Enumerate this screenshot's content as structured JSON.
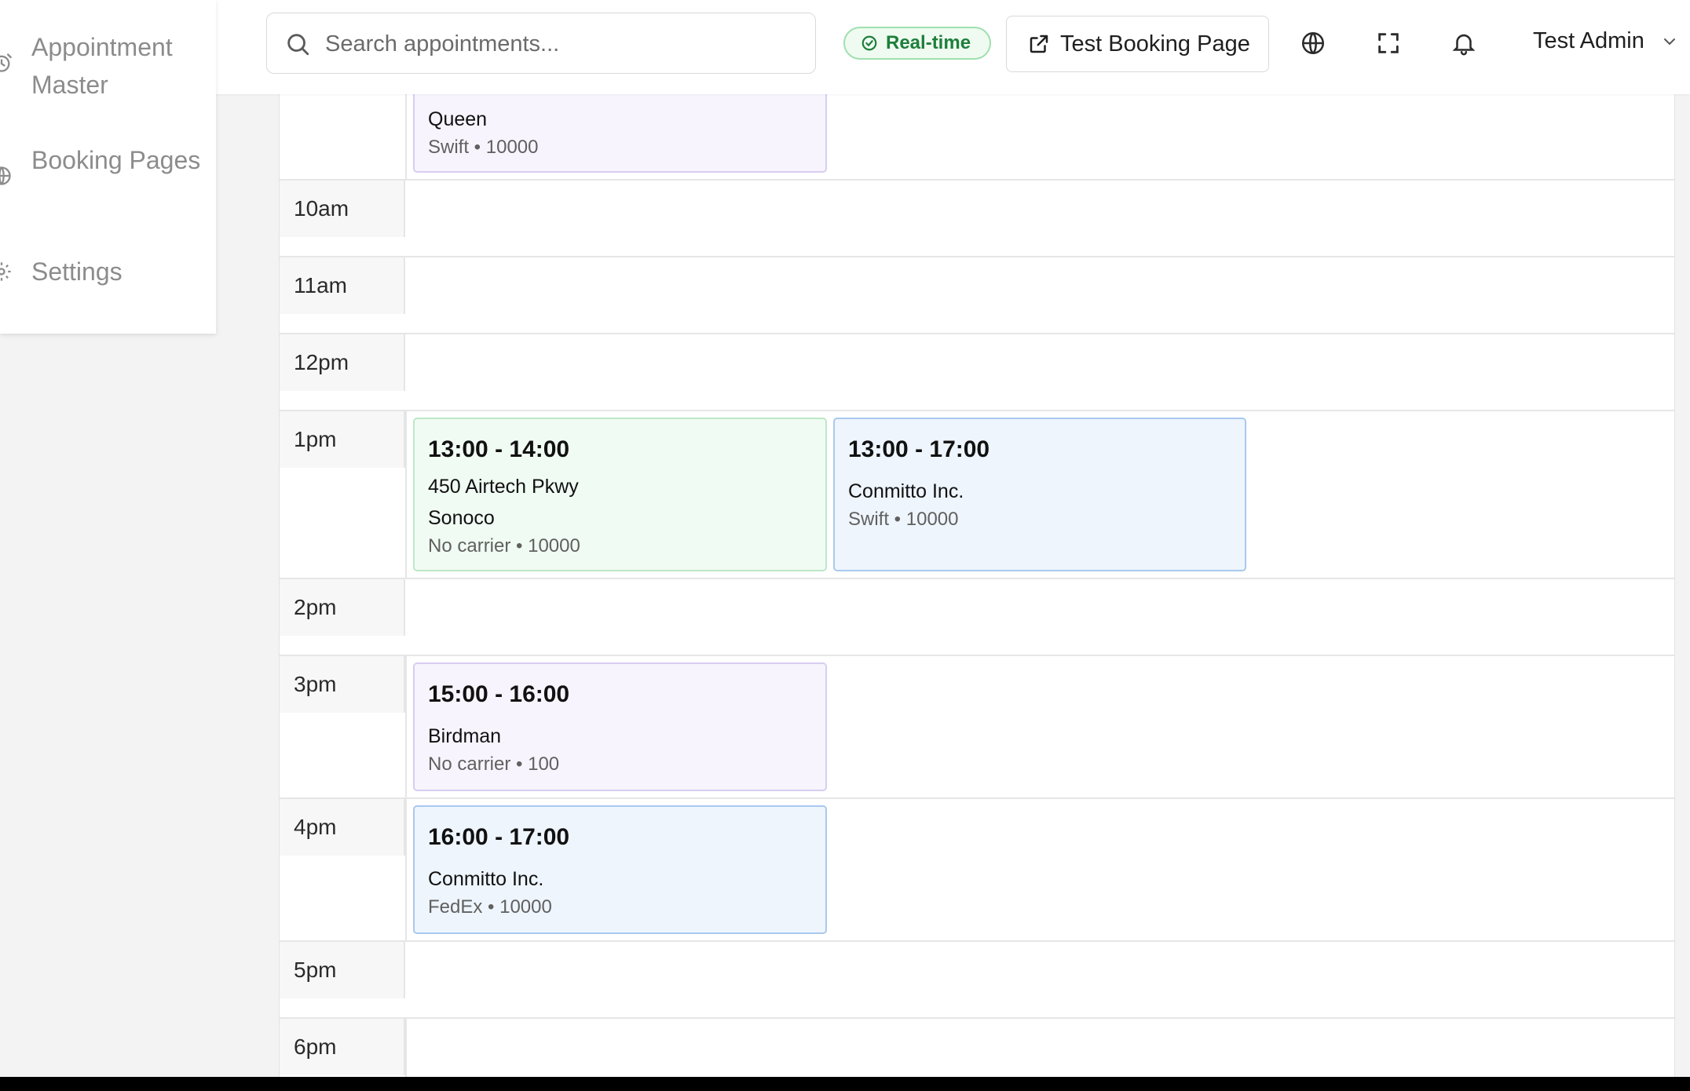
{
  "sidebar": {
    "items": [
      {
        "label": "Appointment Master",
        "icon": "calendar-clock-icon"
      },
      {
        "label": "Booking Pages",
        "icon": "globe-icon"
      },
      {
        "label": "Settings",
        "icon": "gear-icon"
      }
    ]
  },
  "topbar": {
    "search_placeholder": "Search appointments...",
    "realtime_label": "Real-time",
    "booking_button_label": "Test Booking Page",
    "user_name": "Test Admin",
    "icons": [
      "language-globe-icon",
      "fullscreen-icon",
      "bell-icon"
    ]
  },
  "calendar": {
    "hours": [
      "10am",
      "11am",
      "12pm",
      "1pm",
      "2pm",
      "3pm",
      "4pm",
      "5pm",
      "6pm"
    ],
    "appointments": [
      {
        "time": "",
        "name": "Queen",
        "meta": "Swift • 10000",
        "color": "purple"
      },
      {
        "time": "13:00 - 14:00",
        "address": "450 Airtech Pkwy",
        "name": "Sonoco",
        "meta": "No carrier • 10000",
        "color": "green"
      },
      {
        "time": "13:00 - 17:00",
        "name": "Conmitto Inc.",
        "meta": "Swift • 10000",
        "color": "blue"
      },
      {
        "time": "15:00 - 16:00",
        "name": "Birdman",
        "meta": "No carrier • 100",
        "color": "purple"
      },
      {
        "time": "16:00 - 17:00",
        "name": "Conmitto Inc.",
        "meta": "FedEx • 10000",
        "color": "blue"
      }
    ]
  },
  "colors": {
    "purple_bg": "#f7f4fd",
    "green_bg": "#f0fbf3",
    "blue_bg": "#eef5fd",
    "realtime_green": "#1e7f3b"
  }
}
